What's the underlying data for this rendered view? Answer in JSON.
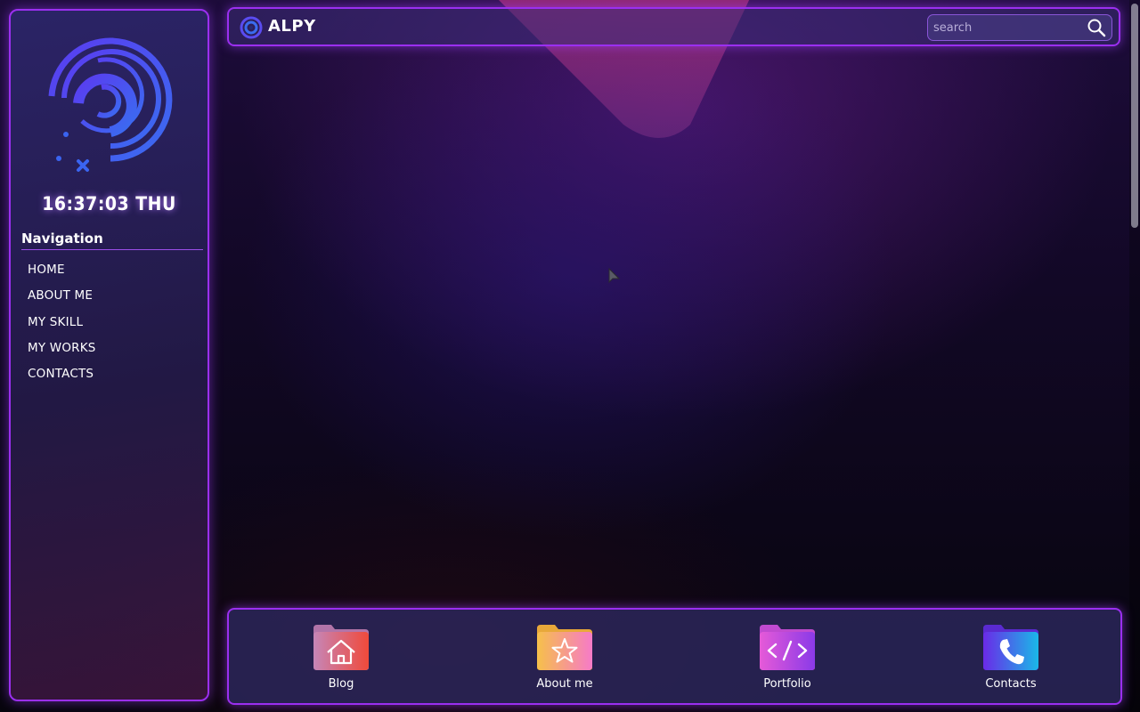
{
  "header": {
    "brand_name": "ALPY",
    "search_placeholder": "search"
  },
  "sidebar": {
    "clock": "16:37:03 THU",
    "navigation_title": "Navigation",
    "items": [
      {
        "label": "HOME"
      },
      {
        "label": "ABOUT ME"
      },
      {
        "label": "MY SKILL"
      },
      {
        "label": "MY WORKS"
      },
      {
        "label": "CONTACTS"
      }
    ]
  },
  "dock": {
    "items": [
      {
        "label": "Blog",
        "icon": "home-icon"
      },
      {
        "label": "About me",
        "icon": "star-icon"
      },
      {
        "label": "Portfolio",
        "icon": "code-icon"
      },
      {
        "label": "Contacts",
        "icon": "phone-icon"
      }
    ]
  },
  "colors": {
    "accent": "#9b2ff0",
    "logo_blue": "#4a46f0"
  }
}
